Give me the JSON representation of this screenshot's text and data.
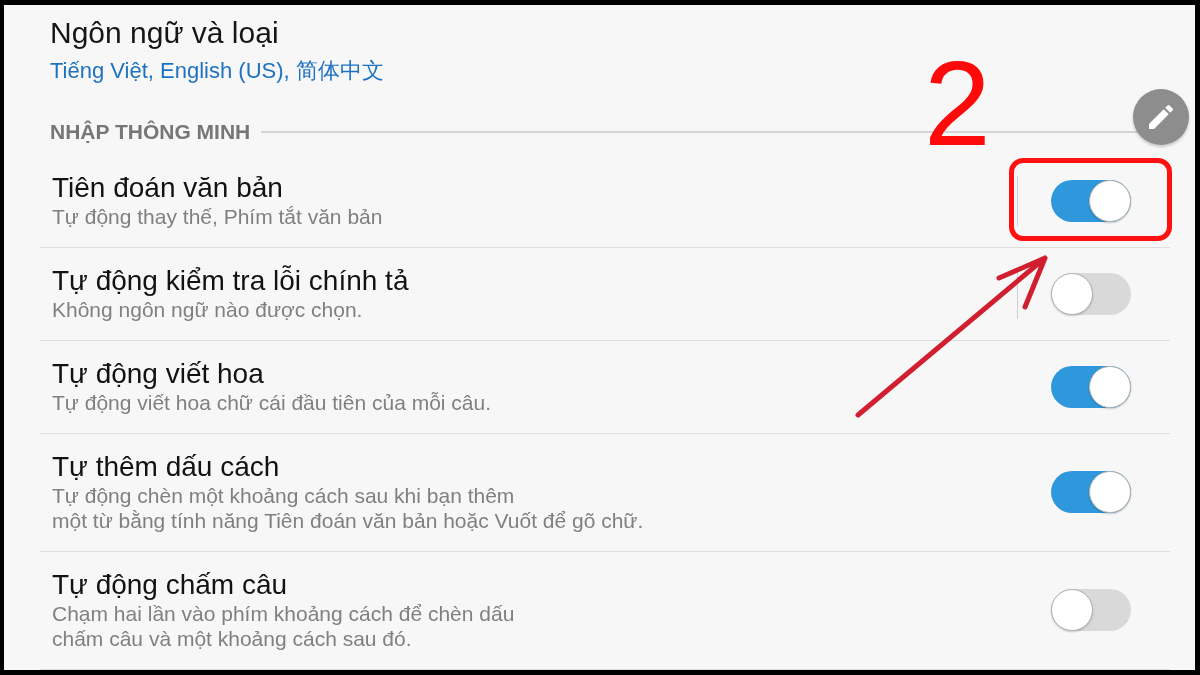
{
  "language_setting": {
    "title": "Ngôn ngữ và loại",
    "value": "Tiếng Việt, English (US), 简体中文"
  },
  "section": {
    "title": "NHẬP THÔNG MINH"
  },
  "settings": [
    {
      "kind": "split",
      "title": "Tiên đoán văn bản",
      "description": "Tự động thay thế, Phím tắt văn bản",
      "on": true,
      "highlighted": true
    },
    {
      "kind": "split",
      "title": "Tự động kiểm tra lỗi chính tả",
      "description": "Không ngôn ngữ nào được chọn.",
      "on": false,
      "highlighted": false
    },
    {
      "kind": "switch",
      "title": "Tự động viết hoa",
      "description": "Tự động viết hoa chữ cái đầu tiên của mỗi câu.",
      "on": true,
      "highlighted": false
    },
    {
      "kind": "switch",
      "title": "Tự thêm dấu cách",
      "description": "Tự động chèn một khoảng cách sau khi bạn thêm\nmột từ bằng tính năng Tiên đoán văn bản hoặc Vuốt để gõ chữ.",
      "on": true,
      "highlighted": false
    },
    {
      "kind": "switch",
      "title": "Tự động chấm câu",
      "description": "Chạm hai lần vào phím khoảng cách để chèn dấu\nchấm câu và một khoảng cách sau đó.",
      "on": false,
      "highlighted": false
    }
  ],
  "annotation": {
    "label": "2"
  }
}
